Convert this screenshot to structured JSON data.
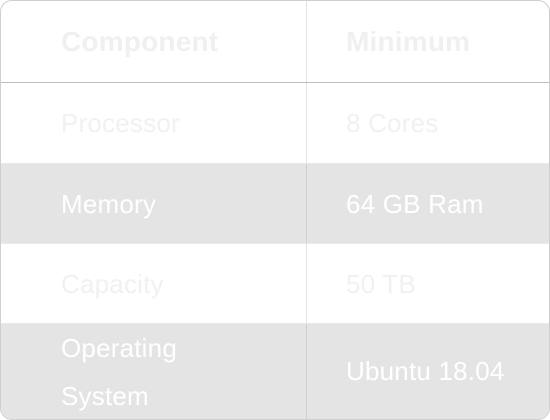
{
  "table": {
    "headers": [
      "Component",
      "Minimum"
    ],
    "rows": [
      [
        "Processor",
        "8 Cores"
      ],
      [
        "Memory",
        "64 GB Ram"
      ],
      [
        "Capacity",
        "50 TB"
      ],
      [
        "Operating System",
        "Ubuntu 18.04"
      ]
    ]
  }
}
